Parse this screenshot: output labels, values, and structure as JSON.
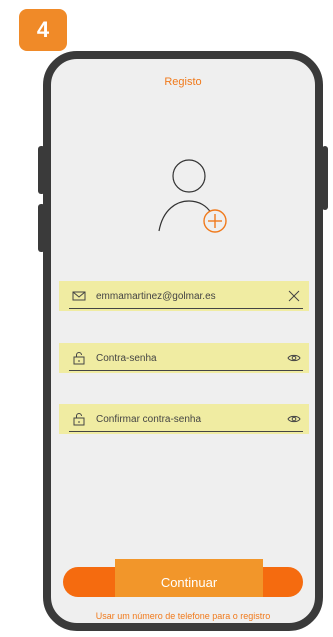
{
  "step": {
    "number": "4"
  },
  "screen": {
    "title": "Registo"
  },
  "avatar": {
    "icon": "user-add-icon"
  },
  "fields": [
    {
      "icon": "mail-icon",
      "value": "emmamartinez@golmar.es",
      "action_icon": "clear-icon"
    },
    {
      "icon": "lock-icon",
      "placeholder": "Contra-senha",
      "action_icon": "eye-icon"
    },
    {
      "icon": "lock-icon",
      "placeholder": "Confirmar contra-senha",
      "action_icon": "eye-icon"
    }
  ],
  "actions": {
    "continue_label": "Continuar",
    "phone_link_label": "Usar um número de telefone para o registro"
  },
  "colors": {
    "accent": "#f07a1c",
    "button": "#f56b0f",
    "badge": "#f08a28",
    "highlight": "#f0eca2",
    "frame": "#3a3a3a"
  }
}
